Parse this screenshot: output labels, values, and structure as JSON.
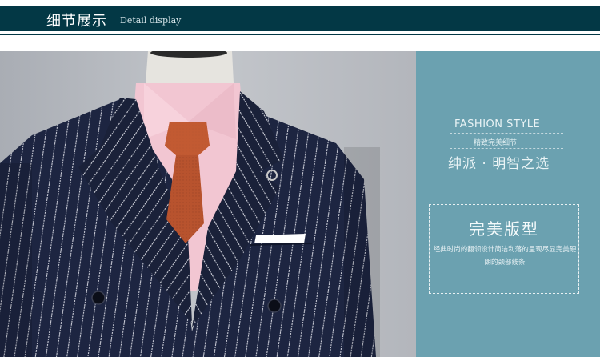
{
  "header": {
    "title": "细节展示",
    "subtitle": "Detail display"
  },
  "panel": {
    "fashion_title": "FASHION STYLE",
    "fashion_sub": "精致完美细节",
    "slogan": "绅派 · 明智之选",
    "box_title": "完美版型",
    "box_text": "经典时尚的翻领设计简洁利落的呈现尽显完美硬朗的颈部线条"
  },
  "colors": {
    "header_bg": "#033845",
    "panel_bg": "#6ba1b0",
    "suit": "#1d2541",
    "shirt": "#f2c6d2",
    "tie": "#b8532e",
    "backdrop": "#b9bcc2"
  }
}
